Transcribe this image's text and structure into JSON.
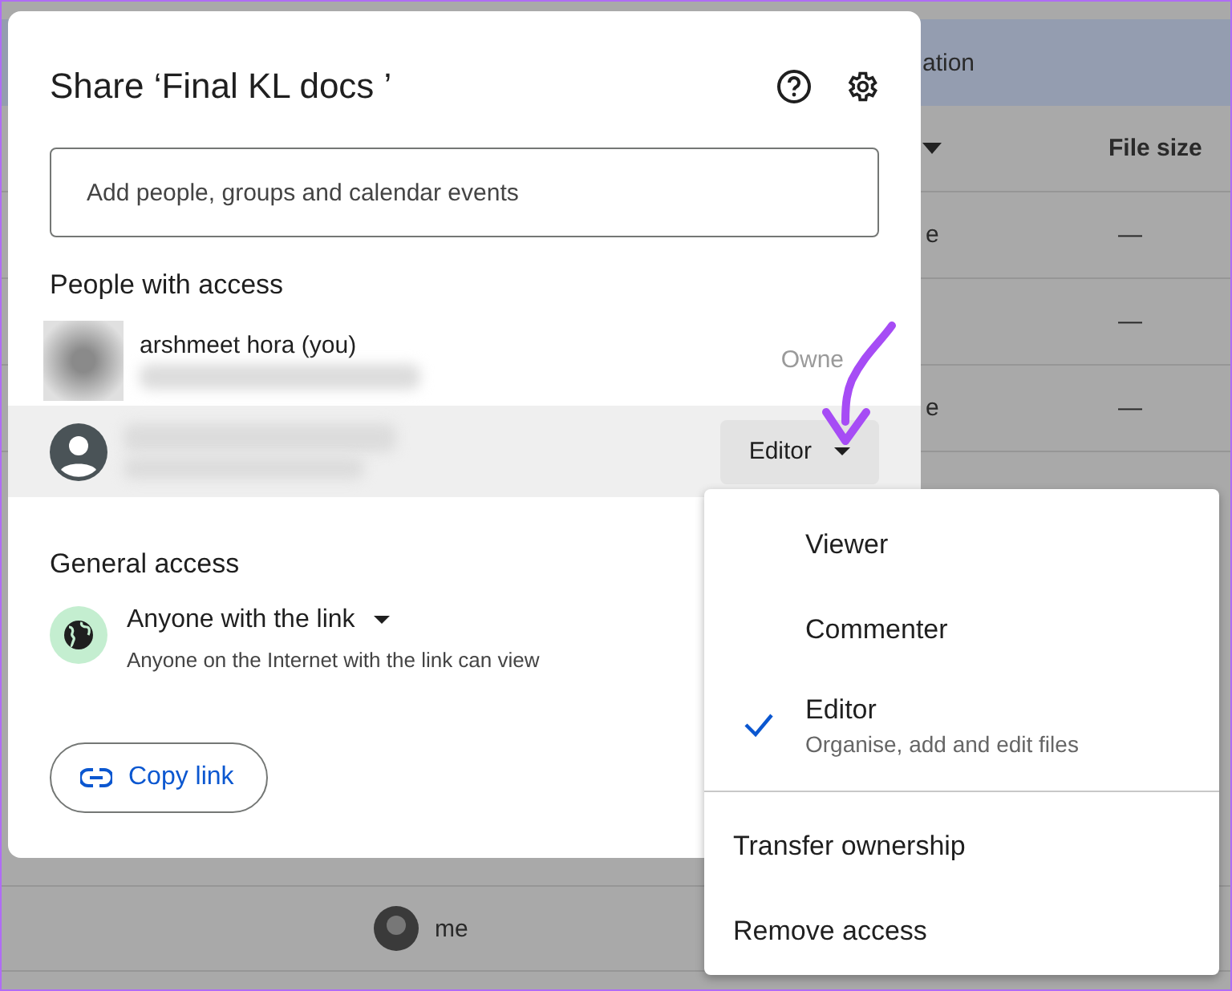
{
  "background": {
    "header": "ation",
    "columns": [
      {
        "label": "File size"
      }
    ],
    "rows": [
      {
        "column_1": "e",
        "column_2": "—"
      },
      {
        "column_2": "—"
      },
      {
        "column_1": "e",
        "column_2": "—"
      }
    ],
    "bottom_rows": [
      {
        "owner": "me"
      }
    ]
  },
  "dialog": {
    "title": "Share ‘Final KL docs ’",
    "search": {
      "placeholder": "Add people, groups and calendar events"
    },
    "people_heading": "People with access",
    "people": [
      {
        "kind": "owner",
        "name": "arshmeet hora (you)",
        "role": "Owne",
        "highlighted": false
      },
      {
        "kind": "editor",
        "role": "Editor",
        "highlighted": true
      }
    ],
    "general_access": {
      "heading": "General access",
      "option": "Anyone with the link",
      "description": "Anyone on the Internet with the link can view"
    },
    "copy_link": "Copy link"
  },
  "menu": {
    "roles": [
      {
        "label": "Viewer",
        "selected": false
      },
      {
        "label": "Commenter",
        "selected": false
      },
      {
        "label": "Editor",
        "description": "Organise, add and edit files",
        "selected": true
      }
    ],
    "actions": [
      "Transfer ownership",
      "Remove access"
    ]
  }
}
